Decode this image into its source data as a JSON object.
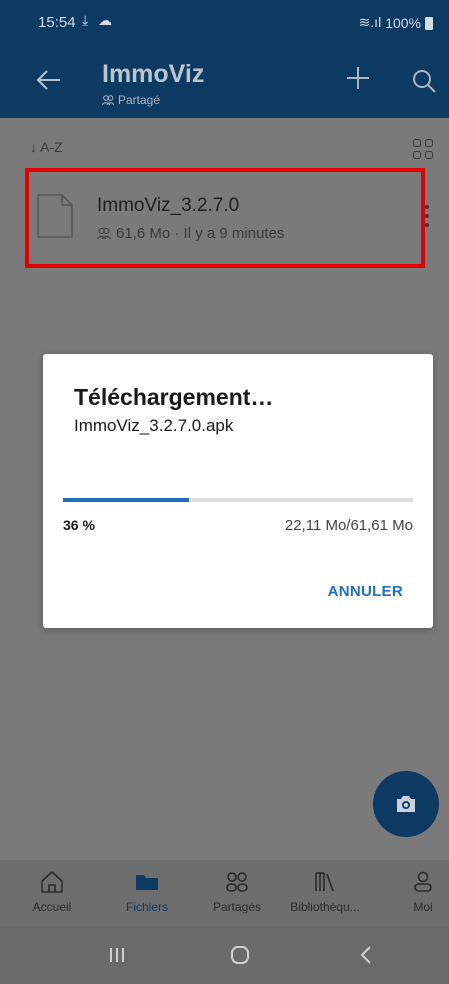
{
  "status_bar": {
    "time": "15:54",
    "download_glyph": "⤓",
    "cloud_glyph": "☁",
    "signal_text": "≋.ıl",
    "battery": "100%"
  },
  "header": {
    "title": "ImmoViz",
    "subtitle": "Partagé"
  },
  "toolbar": {
    "sort_label": "↓ A-Z"
  },
  "file": {
    "name": "ImmoViz_3.2.7.0",
    "meta": "61,6 Mo · Il y a 9 minutes"
  },
  "dialog": {
    "title": "Téléchargement…",
    "filename": "ImmoViz_3.2.7.0.apk",
    "progress_fraction": 0.36,
    "percent_label": "36 %",
    "sizes_label": "22,11 Mo/61,61 Mo",
    "cancel_label": "ANNULER"
  },
  "bottom_nav": {
    "items": [
      {
        "label": "Accueil",
        "icon": "home-icon"
      },
      {
        "label": "Fichiers",
        "icon": "folder-icon"
      },
      {
        "label": "Partagés",
        "icon": "people-icon"
      },
      {
        "label": "Bibliothèqu...",
        "icon": "library-icon"
      },
      {
        "label": "Moi",
        "icon": "person-icon"
      }
    ],
    "active_index": 1
  },
  "colors": {
    "accent": "#1f6fc3",
    "header_bg": "#0d3a63",
    "highlight_border": "#e00000"
  }
}
